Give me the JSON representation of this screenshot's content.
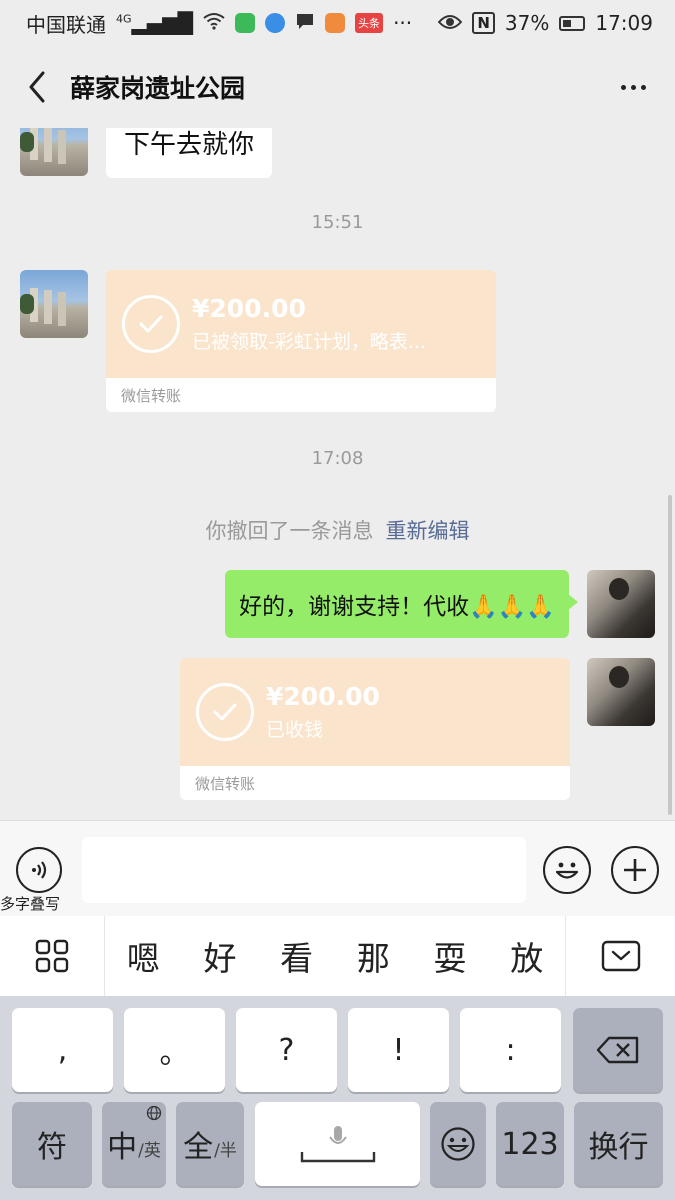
{
  "status_bar": {
    "carrier": "中国联通",
    "network": "4G",
    "toutiao_badge": "头条",
    "more_dots": "···",
    "nfc": "N",
    "battery": "37%",
    "time": "17:09"
  },
  "nav": {
    "title": "薛家岗遗址公园"
  },
  "messages": {
    "first_text": "下午去就你",
    "time_1": "15:51",
    "transfer_1": {
      "amount": "¥200.00",
      "desc": "已被领取-彩虹计划，略表...",
      "footer": "微信转账"
    },
    "time_2": "17:08",
    "recall_text": "你撤回了一条消息",
    "recall_edit": "重新编辑",
    "reply_text": "好的，谢谢支持！代收🙏🙏🙏",
    "transfer_2": {
      "amount": "¥200.00",
      "desc": "已收钱",
      "footer": "微信转账"
    }
  },
  "input_bar": {
    "voice_label": "多字叠写",
    "placeholder": ""
  },
  "candidates": [
    "嗯",
    "好",
    "看",
    "那",
    "耍",
    "放"
  ],
  "keyboard": {
    "row1": [
      ",",
      "。",
      "?",
      "!",
      ":"
    ],
    "fu": "符",
    "zhong": "中",
    "ying": "/英",
    "quan": "全",
    "ban": "/半",
    "num": "123",
    "enter": "换行"
  },
  "colors": {
    "green_bubble": "#95ec69",
    "transfer_orange": "#fbe4cc",
    "link_blue": "#576b95"
  }
}
